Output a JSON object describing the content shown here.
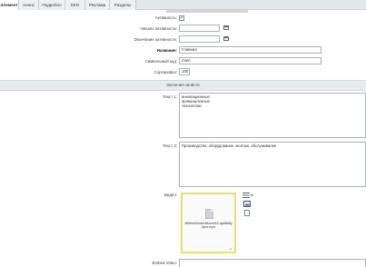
{
  "tabs": [
    {
      "label": "Элемент",
      "active": true
    },
    {
      "label": "Анонс",
      "active": false
    },
    {
      "label": "Подробно",
      "active": false
    },
    {
      "label": "SEO",
      "active": false
    },
    {
      "label": "Реклама",
      "active": false
    },
    {
      "label": "Разделы",
      "active": false
    }
  ],
  "fields": {
    "activity_label": "Активность:",
    "activity_checked": true,
    "active_from_label": "Начало активности:",
    "active_to_label": "Окончание активности:",
    "name_label": "Название:",
    "name_value": "Главная",
    "code_label": "Символьный код:",
    "code_value": "main",
    "sort_label": "Сортировка:",
    "sort_value": "100"
  },
  "section_title": "Значения свойств",
  "properties": {
    "text1_label": "Текст 1:",
    "text1_value": "инновационные\nпромышленные\nтехнологии",
    "text2_label": "Текст 2:",
    "text2_value": "Производство, оборудование, монтаж, обслуживание",
    "video_label": "Видео:",
    "video_file": "/diferent/index8bumek3-ap6868y4ynx.mp4",
    "video_remove": "x",
    "embed_label": "Embed Video:"
  },
  "icons": [
    "checkmark-icon",
    "calendar-icon",
    "file-icon",
    "menu-icon",
    "image-icon",
    "document-icon"
  ]
}
